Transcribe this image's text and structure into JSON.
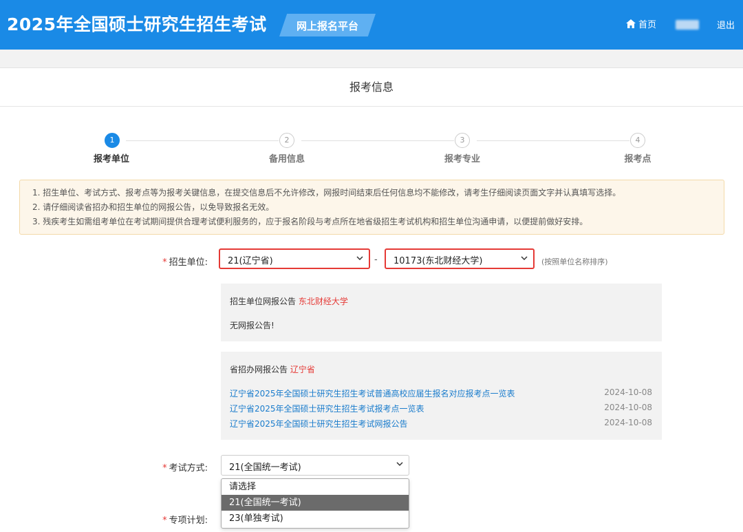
{
  "header": {
    "title": "2025年全国硕士研究生招生考试",
    "platform": "网上报名平台",
    "home_label": "首页",
    "logout_label": "退出"
  },
  "panel": {
    "title": "报考信息"
  },
  "steps": [
    {
      "num": "1",
      "label": "报考单位",
      "active": true
    },
    {
      "num": "2",
      "label": "备用信息",
      "active": false
    },
    {
      "num": "3",
      "label": "报考专业",
      "active": false
    },
    {
      "num": "4",
      "label": "报考点",
      "active": false
    }
  ],
  "notice": [
    "1. 招生单位、考试方式、报考点等为报考关键信息，在提交信息后不允许修改，网报时间结束后任何信息均不能修改，请考生仔细阅读页面文字并认真填写选择。",
    "2. 请仔细阅读省招办和招生单位的网报公告，以免导致报名无效。",
    "3. 残疾考生如需组考单位在考试期间提供合理考试便利服务的，应于报名阶段与考点所在地省级招生考试机构和招生单位沟通申请，以便提前做好安排。"
  ],
  "form": {
    "required_mark": "*",
    "unit_label": "招生单位:",
    "province_value": "21(辽宁省)",
    "dash": "-",
    "school_value": "10173(东北财经大学)",
    "sort_hint": "(按照单位名称排序)",
    "exam_mode_label": "考试方式:",
    "exam_mode_value": "21(全国统一考试)",
    "special_plan_label": "专项计划:"
  },
  "unit_notice": {
    "title": "招生单位网报公告",
    "org": "东北财经大学",
    "empty_text": "无网报公告!"
  },
  "province_notice": {
    "title": "省招办网报公告",
    "org": "辽宁省",
    "links": [
      {
        "text": "辽宁省2025年全国硕士研究生招生考试普通高校应届生报名对应报考点一览表",
        "date": "2024-10-08"
      },
      {
        "text": "辽宁省2025年全国硕士研究生招生考试报考点一览表",
        "date": "2024-10-08"
      },
      {
        "text": "辽宁省2025年全国硕士研究生招生考试网报公告",
        "date": "2024-10-08"
      }
    ]
  },
  "exam_mode_options": [
    {
      "label": "请选择",
      "selected": false
    },
    {
      "label": "21(全国统一考试)",
      "selected": true
    },
    {
      "label": "23(单独考试)",
      "selected": false
    }
  ],
  "colors": {
    "brand": "#1a8ae6",
    "highlight": "#e53935",
    "link": "#1a7ccc"
  }
}
